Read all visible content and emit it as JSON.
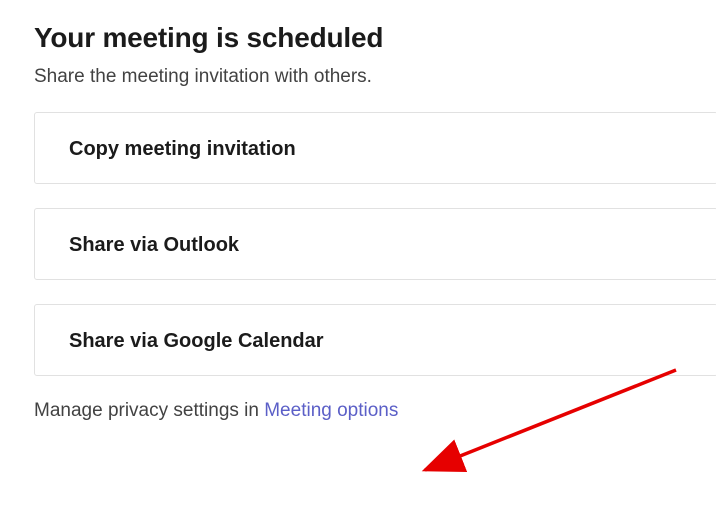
{
  "header": {
    "title": "Your meeting is scheduled",
    "subtitle": "Share the meeting invitation with others."
  },
  "options": {
    "copy_invitation": "Copy meeting invitation",
    "share_outlook": "Share via Outlook",
    "share_google": "Share via Google Calendar"
  },
  "footer": {
    "privacy_prefix": "Manage privacy settings in ",
    "privacy_link": "Meeting options"
  }
}
